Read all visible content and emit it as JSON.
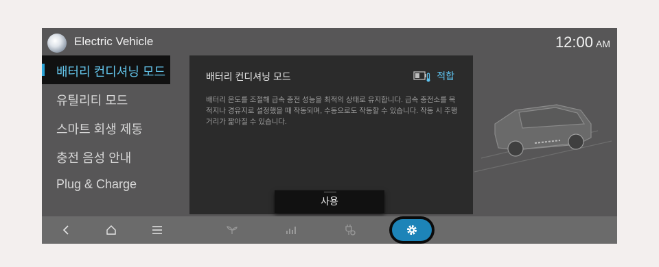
{
  "header": {
    "title": "Electric Vehicle",
    "time": "12:00",
    "ampm": "AM"
  },
  "menu": {
    "items": [
      {
        "label": "배터리 컨디셔닝 모드",
        "active": true
      },
      {
        "label": "유틸리티 모드",
        "active": false
      },
      {
        "label": "스마트 회생 제동",
        "active": false
      },
      {
        "label": "충전 음성 안내",
        "active": false
      },
      {
        "label": "Plug & Charge",
        "active": false
      }
    ]
  },
  "panel": {
    "title": "배터리 컨디셔닝 모드",
    "status": "적합",
    "status_icon": "battery-thermometer-icon",
    "description": "배터리 온도를 조절해 급속 충전 성능을 최적의 상태로 유지합니다. 급속 충전소를 목적지나 경유지로 설정했을 때 작동되며, 수동으로도 작동할 수 있습니다. 작동 시 주행거리가 짧아질 수 있습니다.",
    "button_label": "사용"
  },
  "bottom_bar": {
    "icons": [
      "back-icon",
      "home-icon",
      "menu-icon",
      "eco-leaf-icon",
      "energy-chart-icon",
      "charger-settings-icon",
      "settings-icon"
    ],
    "active": "settings-icon"
  },
  "colors": {
    "accent": "#5ec2ee",
    "active_pill": "#1d84b8",
    "panel_bg": "#2b2b2b",
    "frame_bg": "#575657"
  }
}
